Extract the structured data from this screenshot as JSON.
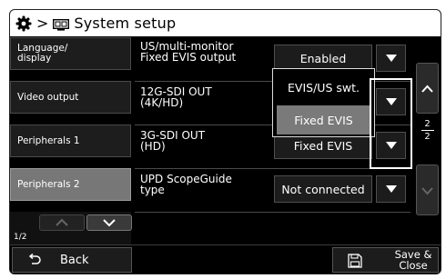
{
  "header": {
    "breadcrumb_sep": ">",
    "title": "System setup",
    "icons": [
      "gear-icon",
      "monitor-icon"
    ]
  },
  "sidebar": {
    "items": [
      {
        "label": "Language/ display",
        "active": false
      },
      {
        "label": "Video output",
        "active": false
      },
      {
        "label": "Peripherals 1",
        "active": false
      },
      {
        "label": "Peripherals 2",
        "active": true
      }
    ],
    "page": "1/2"
  },
  "settings": [
    {
      "label_line1": "US/multi-monitor",
      "label_line2": "Fixed EVIS output",
      "value": "Enabled"
    },
    {
      "label_line1": "12G-SDI OUT",
      "label_line2": "(4K/HD)",
      "value": ""
    },
    {
      "label_line1": "3G-SDI OUT",
      "label_line2": "(HD)",
      "value": "Fixed EVIS"
    },
    {
      "label_line1": "UPD ScopeGuide",
      "label_line2": "type",
      "value": "Not connected"
    }
  ],
  "popup": {
    "options": [
      "EVIS/US swt.",
      "Fixed EVIS"
    ],
    "selected": "Fixed EVIS"
  },
  "pager": {
    "current": "2",
    "total": "2"
  },
  "footer": {
    "back_label": "Back",
    "save_label_line1": "Save &",
    "save_label_line2": "Close"
  },
  "colors": {
    "background": "#000000",
    "active_item": "#777777",
    "title_bar": "#ffffff"
  }
}
